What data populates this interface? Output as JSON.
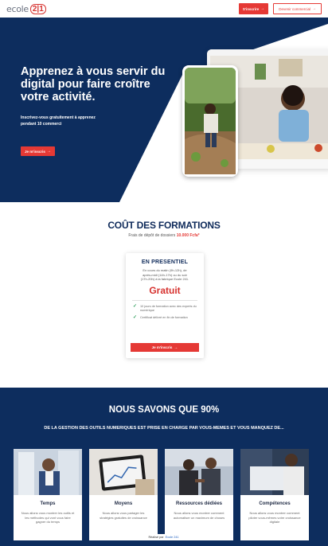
{
  "header": {
    "logo_text": "ecole",
    "logo_badge": "2|1",
    "signup_label": "S'inscrire",
    "become_sales_label": "Devenir commercial"
  },
  "hero": {
    "title": "Apprenez à vous servir du digital pour faire croître votre activité.",
    "subtitle": "Inscrivez-vous gratuitement à apprenez pendant 10 commerci",
    "cta_label": "Je m'inscris"
  },
  "pricing": {
    "title": "COÛT DES FORMATIONS",
    "fee_text": "Frais de dépôt de dossiers",
    "fee_amount": "10.000 Fcfa*",
    "card": {
      "title": "EN PRESENTIEL",
      "desc_1": "En cours du matin (9h-12h), de",
      "desc_2": "après-midi (14h-17h) ou du soir",
      "desc_3": "(17h-20h) à la fabrique Ecole 241.",
      "price": "Gratuit",
      "features": [
        "10 jours de formation avec des experts du numérique",
        "Certificat délivré en fin de formation"
      ],
      "cta_label": "Je m'inscris"
    }
  },
  "stats": {
    "title": "NOUS SAVONS QUE 90%",
    "subtitle": "DE LA GESTION DES OUTILS NUMERIQUES EST PRISE EN CHARGE PAR VOUS-MEMES ET VOUS MANQUEZ DE...",
    "tiles": [
      {
        "name": "Temps",
        "desc": "Nous allons vous montrer les outils et les méthodes qui vont vous faire gagner du temps"
      },
      {
        "name": "Moyens",
        "desc": "Nous allons vous partager les stratégies gratuites de croissance"
      },
      {
        "name": "Ressources dédiées",
        "desc": "Nous allons vous montrer comment automatiser un maximum de choses"
      },
      {
        "name": "Compétences",
        "desc": "Nous allons vous montrer comment piloter vous-mêmes votre croissance digitale"
      }
    ]
  },
  "footer": {
    "made_by": "Réalisé par",
    "made_by_brand": "Ecole 241"
  },
  "colors": {
    "navy": "#0d2d5e",
    "accent_red": "#e53935",
    "check_green": "#2e9e5b"
  }
}
